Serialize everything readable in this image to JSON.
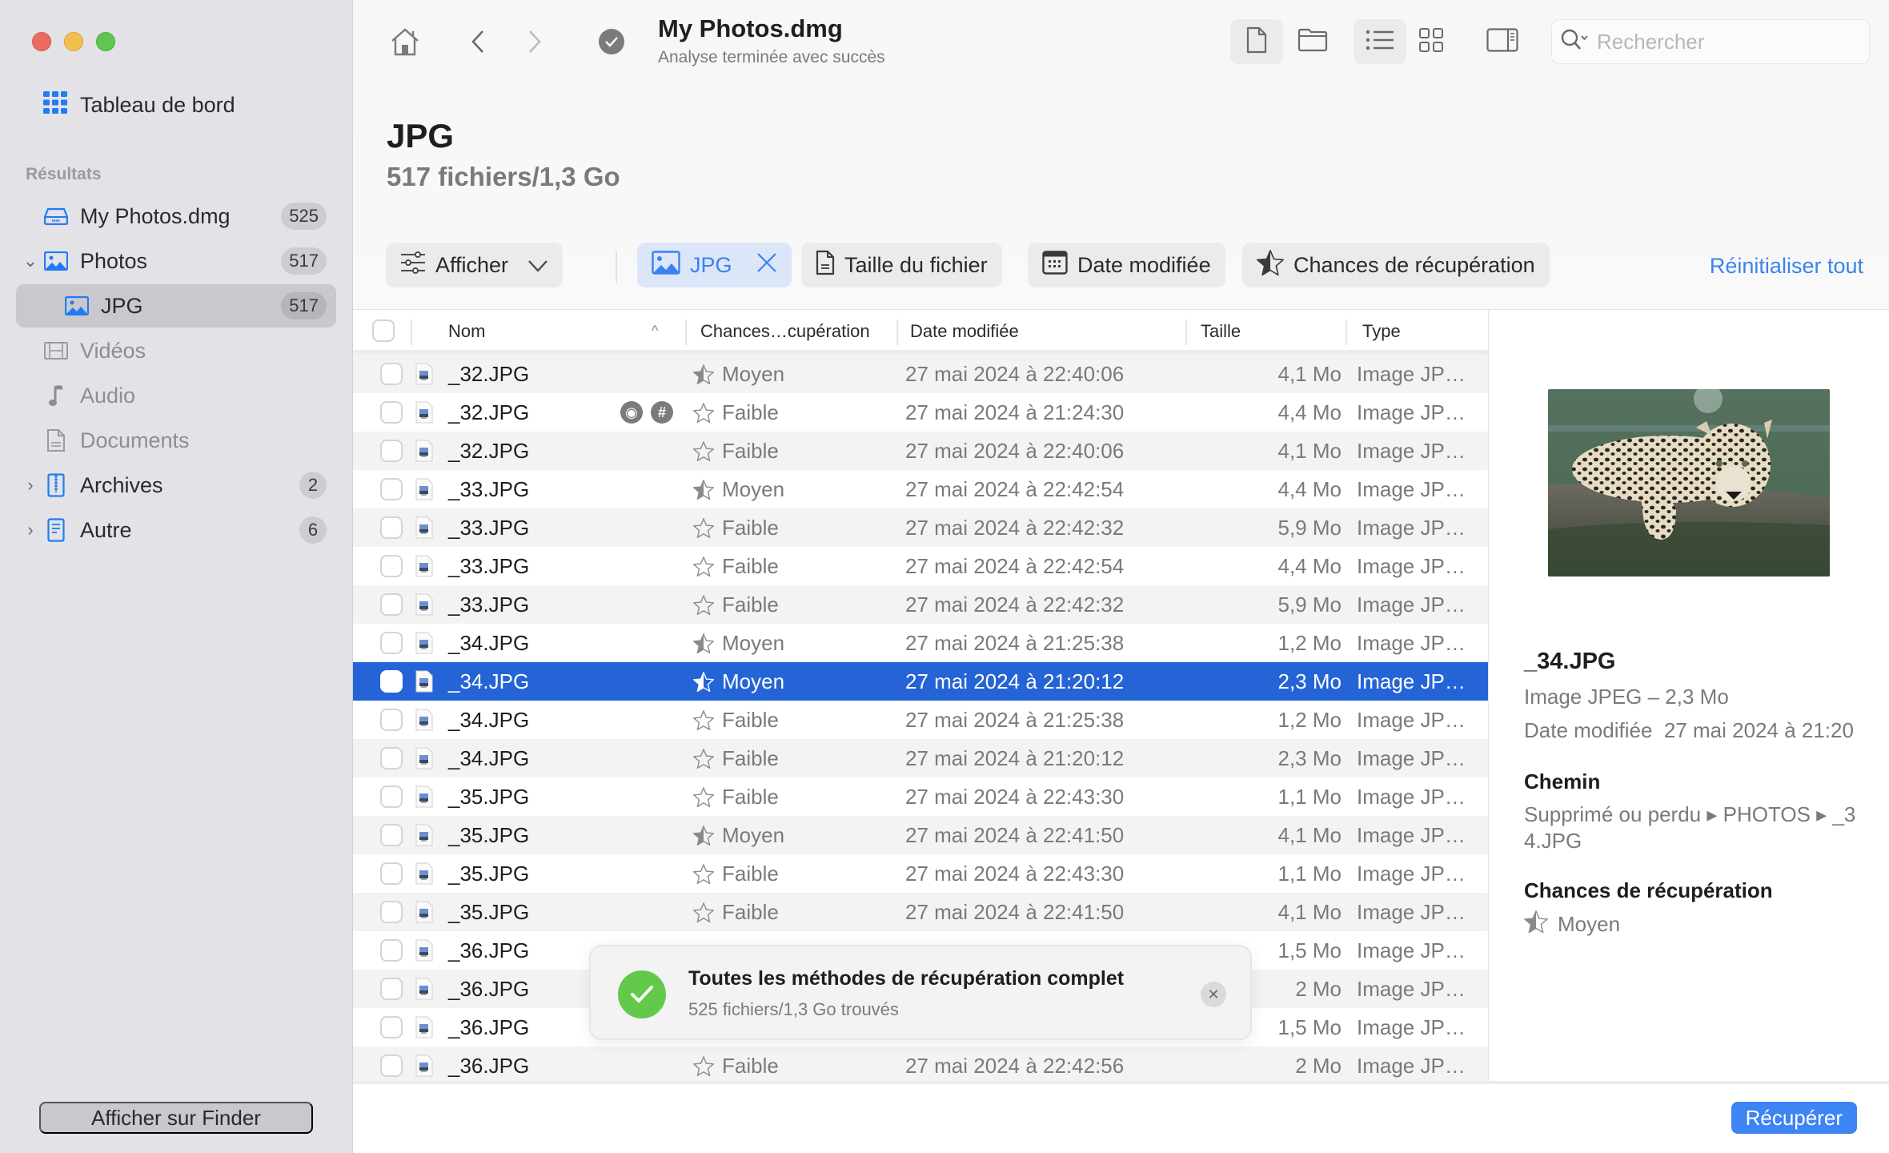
{
  "window": {
    "title": "My Photos.dmg",
    "subtitle": "Analyse terminée avec succès"
  },
  "sidebar": {
    "dashboard_label": "Tableau de bord",
    "section_label": "Résultats",
    "items": [
      {
        "label": "My Photos.dmg",
        "count": "525",
        "icon": "drive-icon"
      },
      {
        "label": "Photos",
        "count": "517",
        "icon": "photo-icon",
        "expanded": true
      },
      {
        "label": "JPG",
        "count": "517",
        "icon": "photo-icon",
        "selected": true
      },
      {
        "label": "Vidéos",
        "count": "",
        "icon": "film-icon"
      },
      {
        "label": "Audio",
        "count": "",
        "icon": "music-note-icon"
      },
      {
        "label": "Documents",
        "count": "",
        "icon": "document-icon"
      },
      {
        "label": "Archives",
        "count": "2",
        "icon": "zip-archive-icon"
      },
      {
        "label": "Autre",
        "count": "6",
        "icon": "other-file-icon"
      }
    ],
    "finder_button": "Afficher sur Finder"
  },
  "toolbar": {
    "search_placeholder": "Rechercher"
  },
  "header": {
    "title": "JPG",
    "subtitle": "517 fichiers/1,3 Go"
  },
  "filters": {
    "show_label": "Afficher",
    "jpg_chip": "JPG",
    "size_chip": "Taille du fichier",
    "date_chip": "Date modifiée",
    "chance_chip": "Chances de récupération",
    "reset": "Réinitialiser tout"
  },
  "table": {
    "columns": {
      "name": "Nom",
      "chance": "Chances…cupération",
      "date": "Date modifiée",
      "size": "Taille",
      "type": "Type"
    },
    "rows": [
      {
        "name": "_32.JPG",
        "chance": "Moyen",
        "date": "27 mai 2024 à 22:40:06",
        "size": "4,1 Mo",
        "type": "Image JP…"
      },
      {
        "name": "_32.JPG",
        "chance": "Faible",
        "date": "27 mai 2024 à 21:24:30",
        "size": "4,4 Mo",
        "type": "Image JP…",
        "hover": true
      },
      {
        "name": "_32.JPG",
        "chance": "Faible",
        "date": "27 mai 2024 à 22:40:06",
        "size": "4,1 Mo",
        "type": "Image JP…"
      },
      {
        "name": "_33.JPG",
        "chance": "Moyen",
        "date": "27 mai 2024 à 22:42:54",
        "size": "4,4 Mo",
        "type": "Image JP…"
      },
      {
        "name": "_33.JPG",
        "chance": "Faible",
        "date": "27 mai 2024 à 22:42:32",
        "size": "5,9 Mo",
        "type": "Image JP…"
      },
      {
        "name": "_33.JPG",
        "chance": "Faible",
        "date": "27 mai 2024 à 22:42:54",
        "size": "4,4 Mo",
        "type": "Image JP…"
      },
      {
        "name": "_33.JPG",
        "chance": "Faible",
        "date": "27 mai 2024 à 22:42:32",
        "size": "5,9 Mo",
        "type": "Image JP…"
      },
      {
        "name": "_34.JPG",
        "chance": "Moyen",
        "date": "27 mai 2024 à 21:25:38",
        "size": "1,2 Mo",
        "type": "Image JP…"
      },
      {
        "name": "_34.JPG",
        "chance": "Moyen",
        "date": "27 mai 2024 à 21:20:12",
        "size": "2,3 Mo",
        "type": "Image JP…",
        "selected": true
      },
      {
        "name": "_34.JPG",
        "chance": "Faible",
        "date": "27 mai 2024 à 21:25:38",
        "size": "1,2 Mo",
        "type": "Image JP…"
      },
      {
        "name": "_34.JPG",
        "chance": "Faible",
        "date": "27 mai 2024 à 21:20:12",
        "size": "2,3 Mo",
        "type": "Image JP…"
      },
      {
        "name": "_35.JPG",
        "chance": "Faible",
        "date": "27 mai 2024 à 22:43:30",
        "size": "1,1 Mo",
        "type": "Image JP…"
      },
      {
        "name": "_35.JPG",
        "chance": "Moyen",
        "date": "27 mai 2024 à 22:41:50",
        "size": "4,1 Mo",
        "type": "Image JP…"
      },
      {
        "name": "_35.JPG",
        "chance": "Faible",
        "date": "27 mai 2024 à 22:43:30",
        "size": "1,1 Mo",
        "type": "Image JP…"
      },
      {
        "name": "_35.JPG",
        "chance": "Faible",
        "date": "27 mai 2024 à 22:41:50",
        "size": "4,1 Mo",
        "type": "Image JP…"
      },
      {
        "name": "_36.JPG",
        "chance": "",
        "date": "",
        "size": "1,5 Mo",
        "type": "Image JP…"
      },
      {
        "name": "_36.JPG",
        "chance": "",
        "date": "",
        "size": "2 Mo",
        "type": "Image JP…"
      },
      {
        "name": "_36.JPG",
        "chance": "",
        "date": "",
        "size": "1,5 Mo",
        "type": "Image JP…"
      },
      {
        "name": "_36.JPG",
        "chance": "Faible",
        "date": "27 mai 2024 à 22:42:56",
        "size": "2 Mo",
        "type": "Image JP…"
      }
    ]
  },
  "toast": {
    "title": "Toutes les méthodes de récupération complet",
    "subtitle": "525 fichiers/1,3 Go trouvés"
  },
  "preview": {
    "name": "_34.JPG",
    "kind_size": "Image JPEG – 2,3 Mo",
    "date_label": "Date modifiée",
    "date_value": "27 mai 2024 à 21:20",
    "path_heading": "Chemin",
    "path": "Supprimé ou perdu ▸ PHOTOS ▸ _34.JPG",
    "chance_heading": "Chances de récupération",
    "chance_value": "Moyen"
  },
  "footer": {
    "recover_button": "Récupérer"
  },
  "colors": {
    "accent": "#3d84f4",
    "selection": "#2464d6",
    "success": "#62c94b"
  }
}
